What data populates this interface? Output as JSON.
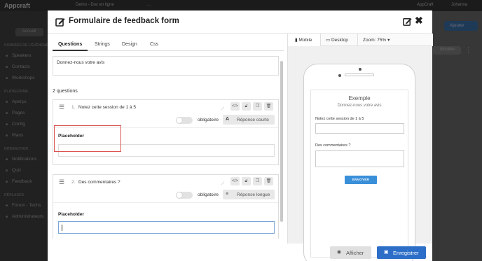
{
  "background": {
    "logo": "Appcraft",
    "event_select": "Demo - Doc en ligne",
    "link": "...",
    "app_label": "AppCraft",
    "user": "Johanna",
    "add_button": "Ajouter",
    "edit_button": "Modifier",
    "sidebar_top_button": "Accueil",
    "sidebar": [
      {
        "label": "DONNÉES DE L'ÉVÉNEMENT",
        "type": "section"
      },
      {
        "label": "Speakers",
        "type": "item"
      },
      {
        "label": "Contacts",
        "type": "item"
      },
      {
        "label": "Workshops",
        "type": "item"
      },
      {
        "label": "PLATEFORME",
        "type": "section"
      },
      {
        "label": "Aperçu",
        "type": "item"
      },
      {
        "label": "Pages",
        "type": "item"
      },
      {
        "label": "Config",
        "type": "item"
      },
      {
        "label": "Plans",
        "type": "item"
      },
      {
        "label": "INTERACTION",
        "type": "section"
      },
      {
        "label": "Notifications",
        "type": "item"
      },
      {
        "label": "Quiz",
        "type": "item"
      },
      {
        "label": "Feedback",
        "type": "item"
      },
      {
        "label": "RÉGLAGES",
        "type": "section"
      },
      {
        "label": "Forum - Techs",
        "type": "item"
      },
      {
        "label": "Administrateurs",
        "type": "item"
      }
    ]
  },
  "modal": {
    "title": "Formulaire de feedback form",
    "tabs": [
      {
        "label": "Questions",
        "active": true
      },
      {
        "label": "Strings",
        "active": false
      },
      {
        "label": "Design",
        "active": false
      },
      {
        "label": "Css",
        "active": false
      }
    ],
    "description": "Donnez-nous votre avis",
    "question_count": "2 questions",
    "questions": [
      {
        "number": "1.",
        "label": "Notez cette session de 1 à 5",
        "required_label": "obligatoire",
        "required": false,
        "type_icon": "A",
        "type_label": "Réponse courte",
        "placeholder_label": "Placeholder",
        "placeholder_value": ""
      },
      {
        "number": "2.",
        "label": "Des commentaires ?",
        "required_label": "obligatoire",
        "required": false,
        "type_icon": "≡",
        "type_label": "Réponse longue",
        "placeholder_label": "Placeholder",
        "placeholder_value": ""
      }
    ],
    "preview": {
      "tabs": [
        {
          "label": "Mobile",
          "icon": "phone-icon",
          "active": true
        },
        {
          "label": "Desktop",
          "icon": "monitor-icon",
          "active": false
        },
        {
          "label": "Zoom: 75%",
          "icon": "caret-down-icon",
          "active": false
        }
      ],
      "title": "Exemple",
      "subtitle": "Donnez-nous votre avis",
      "q1_label": "Notez cette session de 1 à 5",
      "q2_label": "Des commentaires ?",
      "send_label": "ENVOYER"
    },
    "footer": {
      "show_label": "Afficher",
      "save_label": "Enregistrer"
    },
    "colors": {
      "primary": "#2d6fc8",
      "preview_button": "#3a8fd9",
      "highlight": "#d9534f"
    }
  }
}
